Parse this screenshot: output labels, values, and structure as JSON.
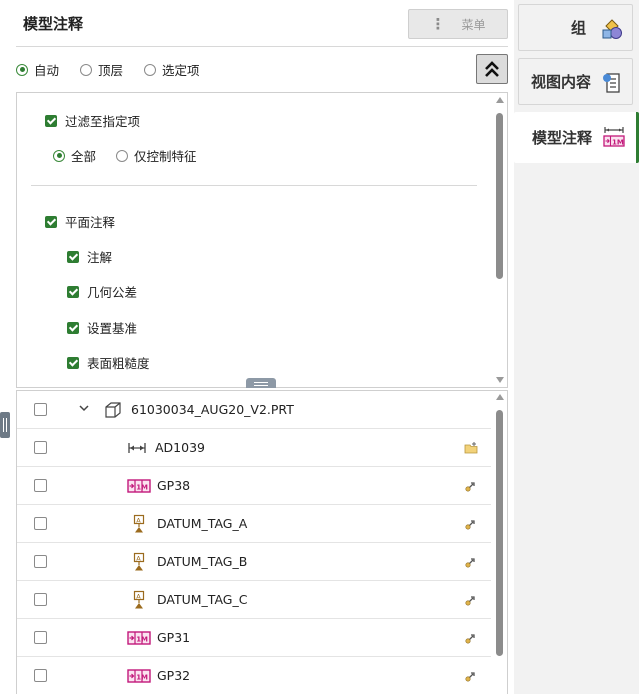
{
  "panel": {
    "title": "模型注释",
    "menu_label": "菜单"
  },
  "radio_options": [
    {
      "label": "自动",
      "selected": true
    },
    {
      "label": "顶层",
      "selected": false
    },
    {
      "label": "选定项",
      "selected": false
    }
  ],
  "filter": {
    "filter_to_specified": "过滤至指定项",
    "all": "全部",
    "control_features_only": "仅控制特征",
    "planar_annotations": "平面注释",
    "items": [
      "注解",
      "几何公差",
      "设置基准",
      "表面粗糙度"
    ]
  },
  "tree": {
    "rows": [
      {
        "label": "61030034_AUG20_V2.PRT",
        "icon": "part-cube-icon"
      },
      {
        "label": "AD1039",
        "icon": "dimension-icon"
      },
      {
        "label": "GP38",
        "icon": "gtol-frame-icon"
      },
      {
        "label": "DATUM_TAG_A",
        "icon": "datum-tag-icon"
      },
      {
        "label": "DATUM_TAG_B",
        "icon": "datum-tag-icon"
      },
      {
        "label": "DATUM_TAG_C",
        "icon": "datum-tag-icon"
      },
      {
        "label": "GP31",
        "icon": "gtol-frame-icon"
      },
      {
        "label": "GP32",
        "icon": "gtol-frame-icon"
      }
    ]
  },
  "tabs": [
    {
      "label": "组",
      "active": false
    },
    {
      "label": "视图内容",
      "active": false
    },
    {
      "label": "模型注释",
      "active": true
    }
  ],
  "colors": {
    "accent_green": "#2e7d32",
    "gtol_magenta": "#c2187a",
    "datum_brown": "#9b6b1e"
  }
}
